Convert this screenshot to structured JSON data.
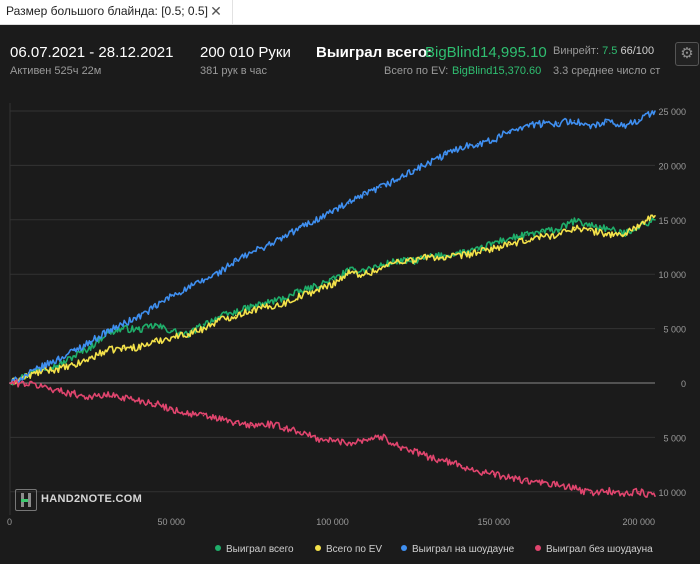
{
  "filter": {
    "label": "Размер большого блайнда: [0.5; 0.5]",
    "close_glyph": "✕"
  },
  "header": {
    "date_range": "06.07.2021 - 28.12.2021",
    "active": "Активен 525ч 22м",
    "hands": "200 010 Руки",
    "hands_per_hour": "381 рук в час",
    "won_label": "Выиграл всего:",
    "won_value": "BigBlind14,995.10",
    "ev_label": "Всего по EV:",
    "ev_value": "BigBlind15,370.60",
    "winrate_label": "Винрейт:",
    "winrate_value": "7.5",
    "winrate_extra": "66/100",
    "avg_line": "3.3 среднее число ст",
    "gear_icon": "gear-icon"
  },
  "logo": {
    "text": "HAND2NOTE.COM"
  },
  "colors": {
    "won_total": "#1fae6a",
    "ev": "#f4e24a",
    "showdown": "#3f8ff0",
    "non_showdown": "#e0456e",
    "accent_green": "#2fbf71"
  },
  "chart_data": {
    "type": "line",
    "title": "",
    "xlabel": "",
    "ylabel": "",
    "xlim": [
      0,
      200000
    ],
    "ylim": [
      -10500,
      25500
    ],
    "x_ticks": [
      0,
      50000,
      100000,
      150000,
      200000
    ],
    "x_tick_labels": [
      "0",
      "50 000",
      "100 000",
      "150 000",
      "200 000"
    ],
    "y_ticks": [
      25000,
      20000,
      15000,
      10000,
      5000,
      0,
      -5000,
      -10000
    ],
    "y_tick_labels": [
      "25 000",
      "20 000",
      "15 000",
      "10 000",
      "5 000",
      "0",
      "5 000",
      "10 000"
    ],
    "grid": true,
    "legend_position": "bottom",
    "x": [
      0,
      5000,
      10000,
      15000,
      20000,
      25000,
      30000,
      35000,
      40000,
      45000,
      50000,
      55000,
      60000,
      65000,
      70000,
      75000,
      80000,
      85000,
      90000,
      95000,
      100000,
      105000,
      110000,
      115000,
      120000,
      125000,
      130000,
      135000,
      140000,
      145000,
      150000,
      155000,
      160000,
      165000,
      170000,
      175000,
      180000,
      185000,
      190000,
      195000,
      200000
    ],
    "series": [
      {
        "name": "Выиграл всего",
        "color": "#1fae6a",
        "values": [
          0,
          700,
          1400,
          1600,
          2500,
          3300,
          4600,
          5000,
          4900,
          5300,
          4800,
          4400,
          5400,
          6100,
          6500,
          7000,
          7400,
          7800,
          8400,
          8900,
          9500,
          10300,
          10400,
          10800,
          11200,
          11200,
          11600,
          11700,
          12000,
          12200,
          12900,
          13300,
          13600,
          13900,
          14100,
          14900,
          14500,
          14200,
          13700,
          14400,
          14995
        ]
      },
      {
        "name": "Всего по EV",
        "color": "#f4e24a",
        "values": [
          0,
          600,
          1100,
          1300,
          1600,
          2300,
          3000,
          3200,
          3300,
          3800,
          4200,
          4500,
          5000,
          5800,
          6200,
          6700,
          7000,
          7300,
          8000,
          8500,
          9100,
          10100,
          10000,
          10500,
          11200,
          11300,
          11600,
          11500,
          11700,
          12000,
          12400,
          12700,
          13100,
          13500,
          13600,
          14300,
          14000,
          13700,
          13600,
          14500,
          15370
        ]
      },
      {
        "name": "Выиграл на шоудауне",
        "color": "#3f8ff0",
        "values": [
          0,
          700,
          1500,
          2200,
          3000,
          3800,
          4700,
          5400,
          6100,
          7000,
          8000,
          8700,
          9400,
          10200,
          11200,
          12000,
          12700,
          13400,
          14300,
          15000,
          15800,
          16500,
          17300,
          18000,
          18700,
          19500,
          20200,
          21000,
          21700,
          22000,
          22300,
          23200,
          23700,
          23800,
          23900,
          24100,
          23500,
          24000,
          23600,
          24200,
          25000
        ]
      },
      {
        "name": "Выиграл без шоудауна",
        "color": "#e0456e",
        "values": [
          0,
          -50,
          -300,
          -700,
          -1000,
          -1300,
          -1100,
          -1300,
          -1600,
          -1900,
          -2400,
          -2800,
          -3000,
          -3300,
          -3700,
          -3900,
          -3800,
          -4100,
          -4500,
          -5100,
          -5300,
          -5500,
          -5200,
          -4900,
          -5700,
          -6300,
          -6800,
          -7200,
          -7600,
          -8100,
          -8400,
          -8700,
          -9000,
          -9200,
          -9400,
          -9700,
          -10100,
          -9900,
          -10200,
          -10000,
          -10400
        ]
      }
    ]
  }
}
